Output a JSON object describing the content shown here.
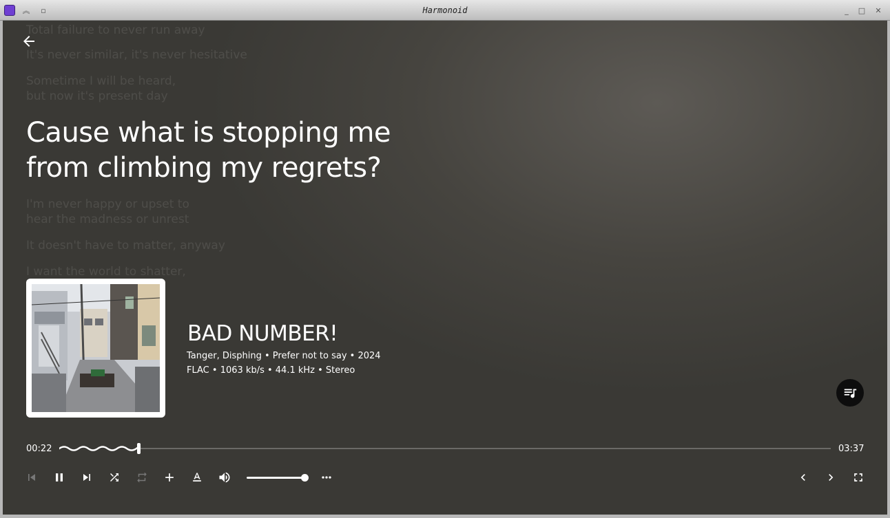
{
  "window": {
    "title": "Harmonoid"
  },
  "lyrics": {
    "before": [
      "Total failure to never run away",
      "It's never similar, it's never hesitative",
      "Sometime I will be heard,\nbut now it's present day"
    ],
    "current": "Cause what is stopping me\nfrom climbing my regrets?",
    "after": [
      "I'm never happy or upset to\nhear the madness or unrest",
      "It doesn't have to matter, anyway",
      "I want the world to shatter,"
    ]
  },
  "track": {
    "title": "BAD NUMBER!",
    "info_line": "Tanger, Disphing • Prefer not to say • 2024",
    "format_line": "FLAC • 1063 kb/s • 44.1 kHz • Stereo"
  },
  "playback": {
    "position": "00:22",
    "duration": "03:37",
    "progress": 0.1,
    "volume": 0.95
  },
  "icons": {
    "back": "arrow-left-icon",
    "previous": "skip-previous-icon",
    "pause": "pause-icon",
    "next": "skip-next-icon",
    "shuffle": "shuffle-icon",
    "repeat": "repeat-icon",
    "add": "plus-icon",
    "lyrics": "text-format-icon",
    "volume": "volume-icon",
    "more": "more-horiz-icon",
    "nav_left": "chevron-left-icon",
    "nav_right": "chevron-right-icon",
    "fullscreen": "fullscreen-icon",
    "queue": "queue-music-icon"
  },
  "colors": {
    "accent": "#ffffff",
    "background": "#3a3936",
    "fab": "#0d0d0d"
  }
}
